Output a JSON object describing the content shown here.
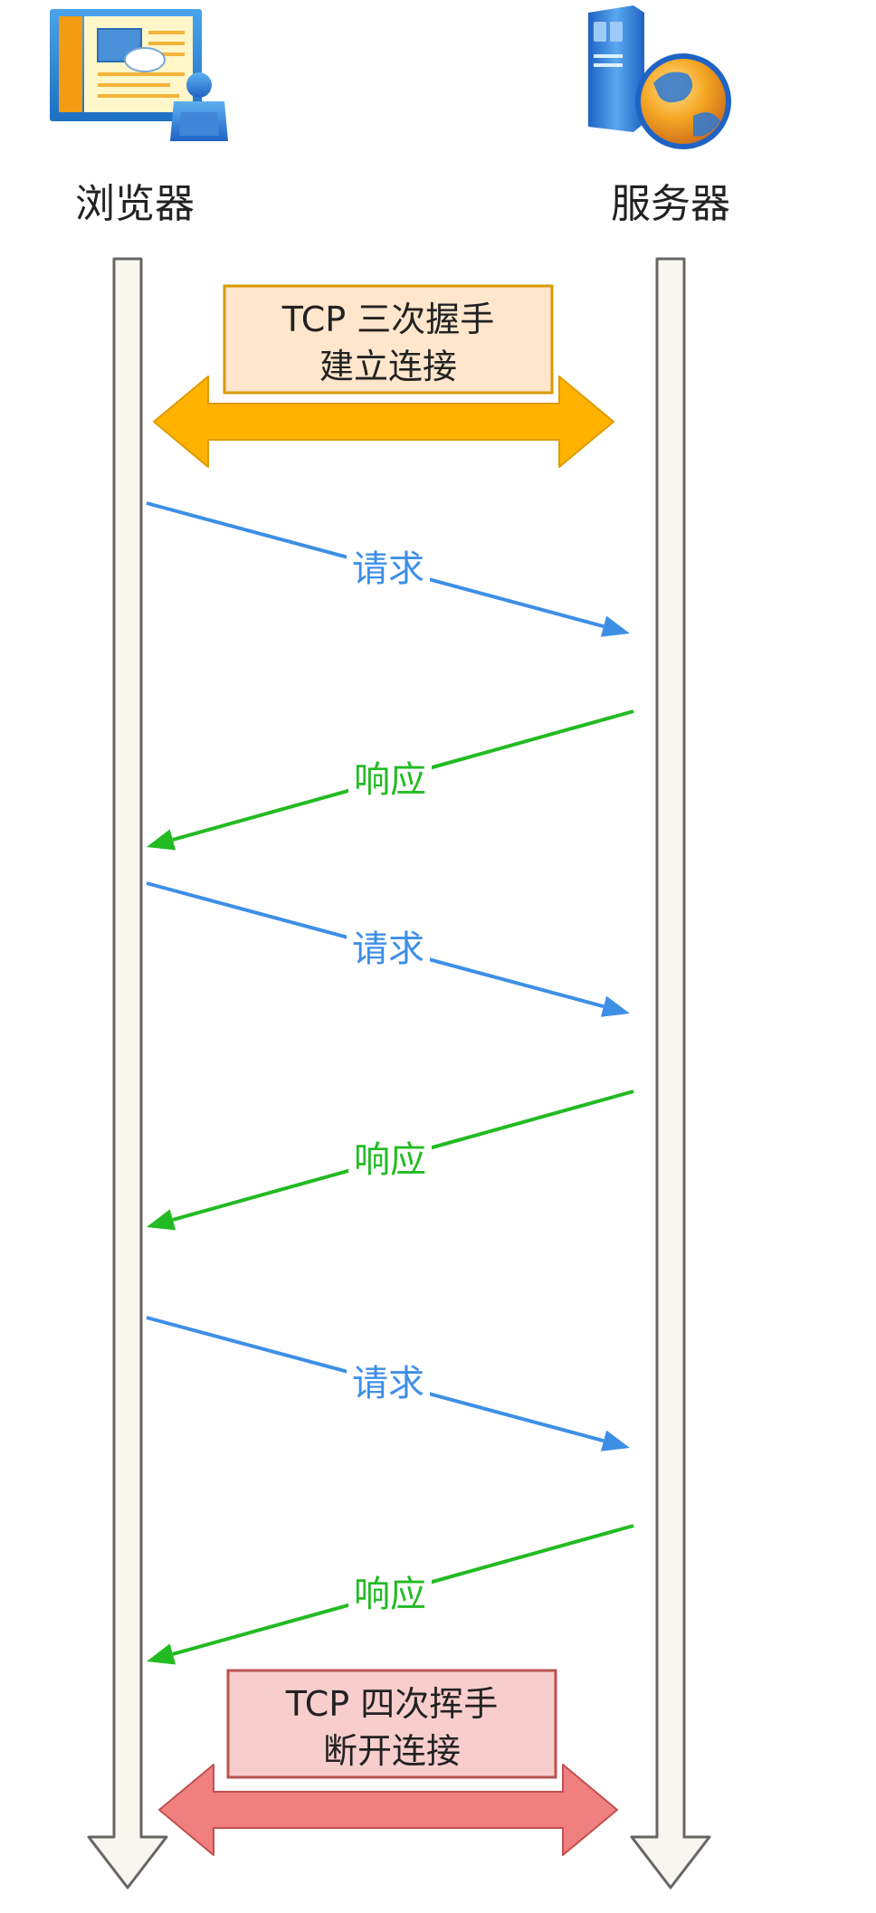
{
  "participants": {
    "browser": {
      "label": "浏览器",
      "icon": "browser-window-icon"
    },
    "server": {
      "label": "服务器",
      "icon": "server-globe-icon"
    }
  },
  "handshake": {
    "line1": "TCP 三次握手",
    "line2": "建立连接",
    "fill": "#ffe6cc",
    "stroke": "#d79b00",
    "arrow_color": "#ffb300"
  },
  "teardown": {
    "line1": "TCP 四次挥手",
    "line2": "断开连接",
    "fill": "#f8cecc",
    "stroke": "#b85450",
    "arrow_color": "#f08080"
  },
  "messages": [
    {
      "label": "请求",
      "direction": "to-server",
      "color": "#3d8fe6"
    },
    {
      "label": "响应",
      "direction": "to-browser",
      "color": "#22bb22"
    },
    {
      "label": "请求",
      "direction": "to-server",
      "color": "#3d8fe6"
    },
    {
      "label": "响应",
      "direction": "to-browser",
      "color": "#22bb22"
    },
    {
      "label": "请求",
      "direction": "to-server",
      "color": "#3d8fe6"
    },
    {
      "label": "响应",
      "direction": "to-browser",
      "color": "#22bb22"
    }
  ],
  "lifeline": {
    "fill": "#f8f6ee",
    "stroke": "#666666"
  }
}
